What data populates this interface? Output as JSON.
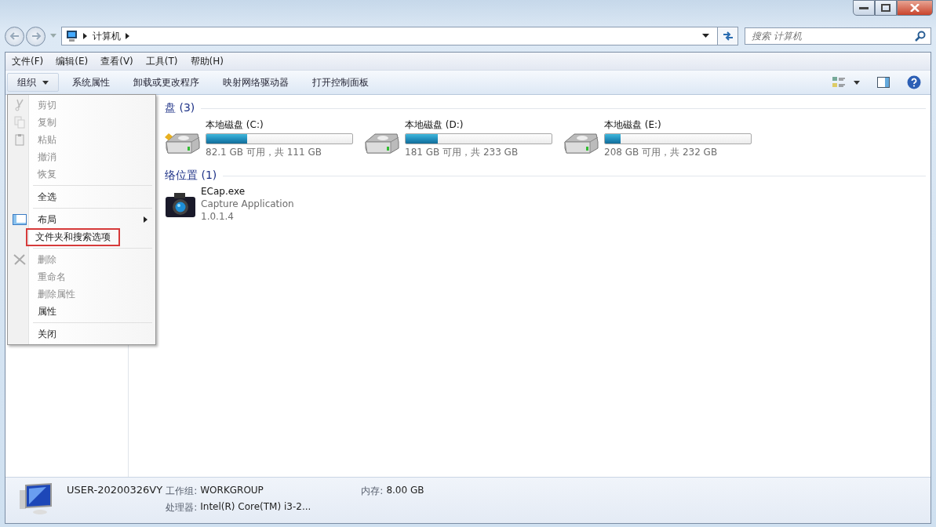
{
  "address": {
    "crumbs": [
      "计算机"
    ]
  },
  "search": {
    "placeholder": "搜索 计算机"
  },
  "menubar": [
    "文件(F)",
    "编辑(E)",
    "查看(V)",
    "工具(T)",
    "帮助(H)"
  ],
  "commands": [
    {
      "label": "组织",
      "dropdown": true
    },
    {
      "label": "系统属性",
      "dropdown": false
    },
    {
      "label": "卸载或更改程序",
      "dropdown": false
    },
    {
      "label": "映射网络驱动器",
      "dropdown": false
    },
    {
      "label": "打开控制面板",
      "dropdown": false
    }
  ],
  "context_menu": [
    {
      "kind": "item",
      "label": "剪切",
      "disabled": true,
      "submenu": false,
      "highlighted": false
    },
    {
      "kind": "item",
      "label": "复制",
      "disabled": true,
      "submenu": false,
      "highlighted": false
    },
    {
      "kind": "item",
      "label": "粘贴",
      "disabled": true,
      "submenu": false,
      "highlighted": false
    },
    {
      "kind": "item",
      "label": "撤消",
      "disabled": true,
      "submenu": false,
      "highlighted": false
    },
    {
      "kind": "item",
      "label": "恢复",
      "disabled": true,
      "submenu": false,
      "highlighted": false
    },
    {
      "kind": "separator"
    },
    {
      "kind": "item",
      "label": "全选",
      "disabled": false,
      "submenu": false,
      "highlighted": false
    },
    {
      "kind": "separator"
    },
    {
      "kind": "item",
      "label": "布局",
      "disabled": false,
      "submenu": true,
      "highlighted": false
    },
    {
      "kind": "item",
      "label": "文件夹和搜索选项",
      "disabled": false,
      "submenu": false,
      "highlighted": true
    },
    {
      "kind": "separator"
    },
    {
      "kind": "item",
      "label": "删除",
      "disabled": true,
      "submenu": false,
      "highlighted": false
    },
    {
      "kind": "item",
      "label": "重命名",
      "disabled": true,
      "submenu": false,
      "highlighted": false
    },
    {
      "kind": "item",
      "label": "删除属性",
      "disabled": true,
      "submenu": false,
      "highlighted": false
    },
    {
      "kind": "item",
      "label": "属性",
      "disabled": false,
      "submenu": false,
      "highlighted": false
    },
    {
      "kind": "separator"
    },
    {
      "kind": "item",
      "label": "关闭",
      "disabled": false,
      "submenu": false,
      "highlighted": false
    }
  ],
  "groups": [
    {
      "title": "盘 (3)",
      "items": [
        {
          "kind": "drive",
          "name": "本地磁盘 (C:)",
          "level": 0.28,
          "detail": "82.1 GB 可用，共 111 GB",
          "system": true
        },
        {
          "kind": "drive",
          "name": "本地磁盘 (D:)",
          "level": 0.22,
          "detail": "181 GB 可用，共 233 GB",
          "system": false
        },
        {
          "kind": "drive",
          "name": "本地磁盘 (E:)",
          "level": 0.11,
          "detail": "208 GB 可用，共 232 GB",
          "system": false
        }
      ]
    },
    {
      "title": "络位置 (1)",
      "items": [
        {
          "kind": "app",
          "name": "ECap.exe",
          "description": "Capture Application",
          "version": "1.0.1.4"
        }
      ]
    }
  ],
  "details": {
    "computer": "USER-20200326VY",
    "workgroup_label": "工作组:",
    "workgroup": "WORKGROUP",
    "memory_label": "内存:",
    "memory": "8.00 GB",
    "processor_label": "处理器:",
    "processor": "Intel(R) Core(TM) i3-2..."
  }
}
